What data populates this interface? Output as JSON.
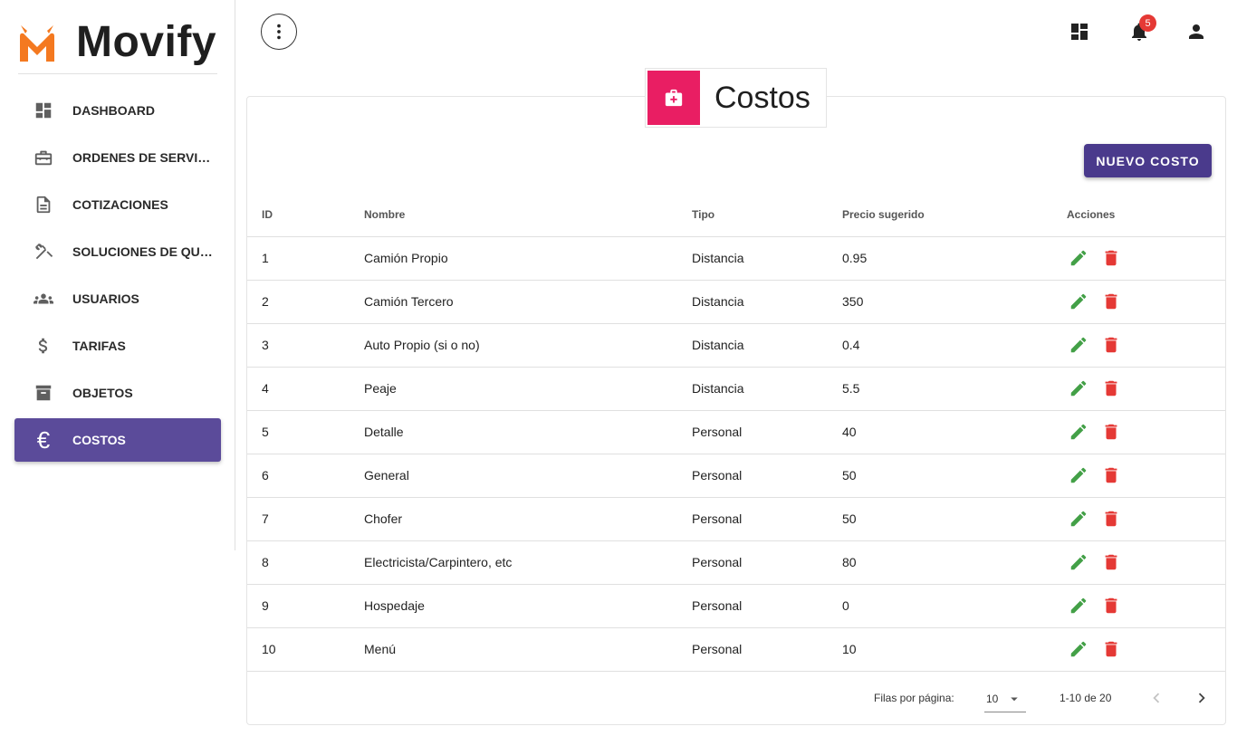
{
  "app": {
    "name": "Movify",
    "brand_color": "#f47920"
  },
  "sidebar": {
    "items": [
      {
        "label": "DASHBOARD",
        "icon": "dashboard-icon"
      },
      {
        "label": "ORDENES DE SERVICIO",
        "icon": "toolbox-icon"
      },
      {
        "label": "COTIZACIONES",
        "icon": "document-icon"
      },
      {
        "label": "SOLUCIONES DE QUIE...",
        "icon": "tools-icon"
      },
      {
        "label": "USUARIOS",
        "icon": "users-icon"
      },
      {
        "label": "TARIFAS",
        "icon": "dollar-icon"
      },
      {
        "label": "OBJETOS",
        "icon": "archive-icon"
      },
      {
        "label": "COSTOS",
        "icon": "euro-icon",
        "active": true
      }
    ],
    "active_color": "#5b4b9a",
    "euro_glyph": "€"
  },
  "topbar": {
    "notifications_count": "5"
  },
  "page": {
    "title": "Costos",
    "header_icon_color": "#e91e63",
    "new_button_label": "NUEVO COSTO",
    "new_button_color": "#4a3a8c"
  },
  "table": {
    "headers": {
      "id": "ID",
      "name": "Nombre",
      "tipo": "Tipo",
      "precio": "Precio sugerido",
      "acciones": "Acciones"
    },
    "rows": [
      {
        "id": "1",
        "nombre": "Camión Propio",
        "tipo": "Distancia",
        "precio": "0.95"
      },
      {
        "id": "2",
        "nombre": "Camión Tercero",
        "tipo": "Distancia",
        "precio": "350"
      },
      {
        "id": "3",
        "nombre": "Auto Propio (si o no)",
        "tipo": "Distancia",
        "precio": "0.4"
      },
      {
        "id": "4",
        "nombre": "Peaje",
        "tipo": "Distancia",
        "precio": "5.5"
      },
      {
        "id": "5",
        "nombre": "Detalle",
        "tipo": "Personal",
        "precio": "40"
      },
      {
        "id": "6",
        "nombre": "General",
        "tipo": "Personal",
        "precio": "50"
      },
      {
        "id": "7",
        "nombre": "Chofer",
        "tipo": "Personal",
        "precio": "50"
      },
      {
        "id": "8",
        "nombre": "Electricista/Carpintero, etc",
        "tipo": "Personal",
        "precio": "80"
      },
      {
        "id": "9",
        "nombre": "Hospedaje",
        "tipo": "Personal",
        "precio": "0"
      },
      {
        "id": "10",
        "nombre": "Menú",
        "tipo": "Personal",
        "precio": "10"
      }
    ],
    "edit_color": "#43a047",
    "delete_color": "#e53935"
  },
  "pagination": {
    "rows_per_page_label": "Filas por página:",
    "rows_per_page_value": "10",
    "range": "1-10 de 20"
  }
}
